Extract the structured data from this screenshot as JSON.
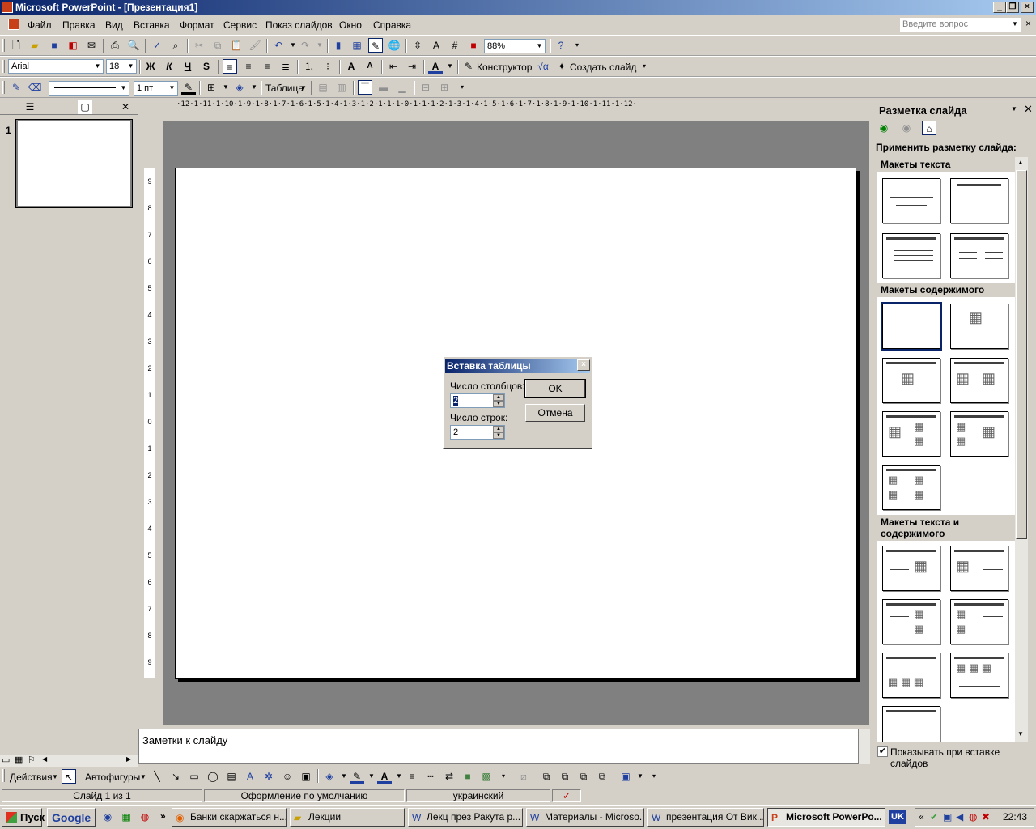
{
  "window": {
    "title": "Microsoft PowerPoint - [Презентация1]"
  },
  "menu": {
    "items": [
      "Файл",
      "Правка",
      "Вид",
      "Вставка",
      "Формат",
      "Сервис",
      "Показ слайдов",
      "Окно",
      "Справка"
    ],
    "help_placeholder": "Введите вопрос"
  },
  "toolbar_standard": {
    "zoom": "88%"
  },
  "toolbar_format": {
    "font": "Arial",
    "size": "18",
    "designer": "Конструктор",
    "new_slide": "Создать слайд"
  },
  "toolbar_tables": {
    "line_width": "1 пт",
    "table": "Таблица"
  },
  "slides_panel": {
    "thumb_number": "1"
  },
  "ruler": {
    "h": "·12·1·11·1·10·1·9·1·8·1·7·1·6·1·5·1·4·1·3·1·2·1·1·1·0·1·1·1·2·1·3·1·4·1·5·1·6·1·7·1·8·1·9·1·10·1·11·1·12·",
    "v": [
      "9",
      "8",
      "7",
      "6",
      "5",
      "4",
      "3",
      "2",
      "1",
      "0",
      "1",
      "2",
      "3",
      "4",
      "5",
      "6",
      "7",
      "8",
      "9"
    ]
  },
  "notes": {
    "placeholder": "Заметки к слайду"
  },
  "taskpane": {
    "title": "Разметка слайда",
    "apply_label": "Применить разметку слайда:",
    "section_text": "Макеты текста",
    "section_content": "Макеты содержимого",
    "section_text_content": "Макеты текста и содержимого",
    "show_on_insert": "Показывать при вставке слайдов"
  },
  "dialog": {
    "title": "Вставка таблицы",
    "cols_label": "Число столбцов:",
    "cols_value": "2",
    "rows_label": "Число строк:",
    "rows_value": "2",
    "ok": "OK",
    "cancel": "Отмена"
  },
  "drawbar": {
    "actions": "Действия",
    "autoshapes": "Автофигуры"
  },
  "status": {
    "slide": "Слайд 1 из 1",
    "design": "Оформление по умолчанию",
    "lang": "украинский"
  },
  "taskbar": {
    "start": "Пуск",
    "google": "Google",
    "buttons": [
      "Банки скаржаться н...",
      "Лекции",
      "Лекц през Ракута р...",
      "Материалы - Microso...",
      "презентация От Вик...",
      "Microsoft PowerPo..."
    ],
    "lang": "UK",
    "clock": "22:43"
  }
}
